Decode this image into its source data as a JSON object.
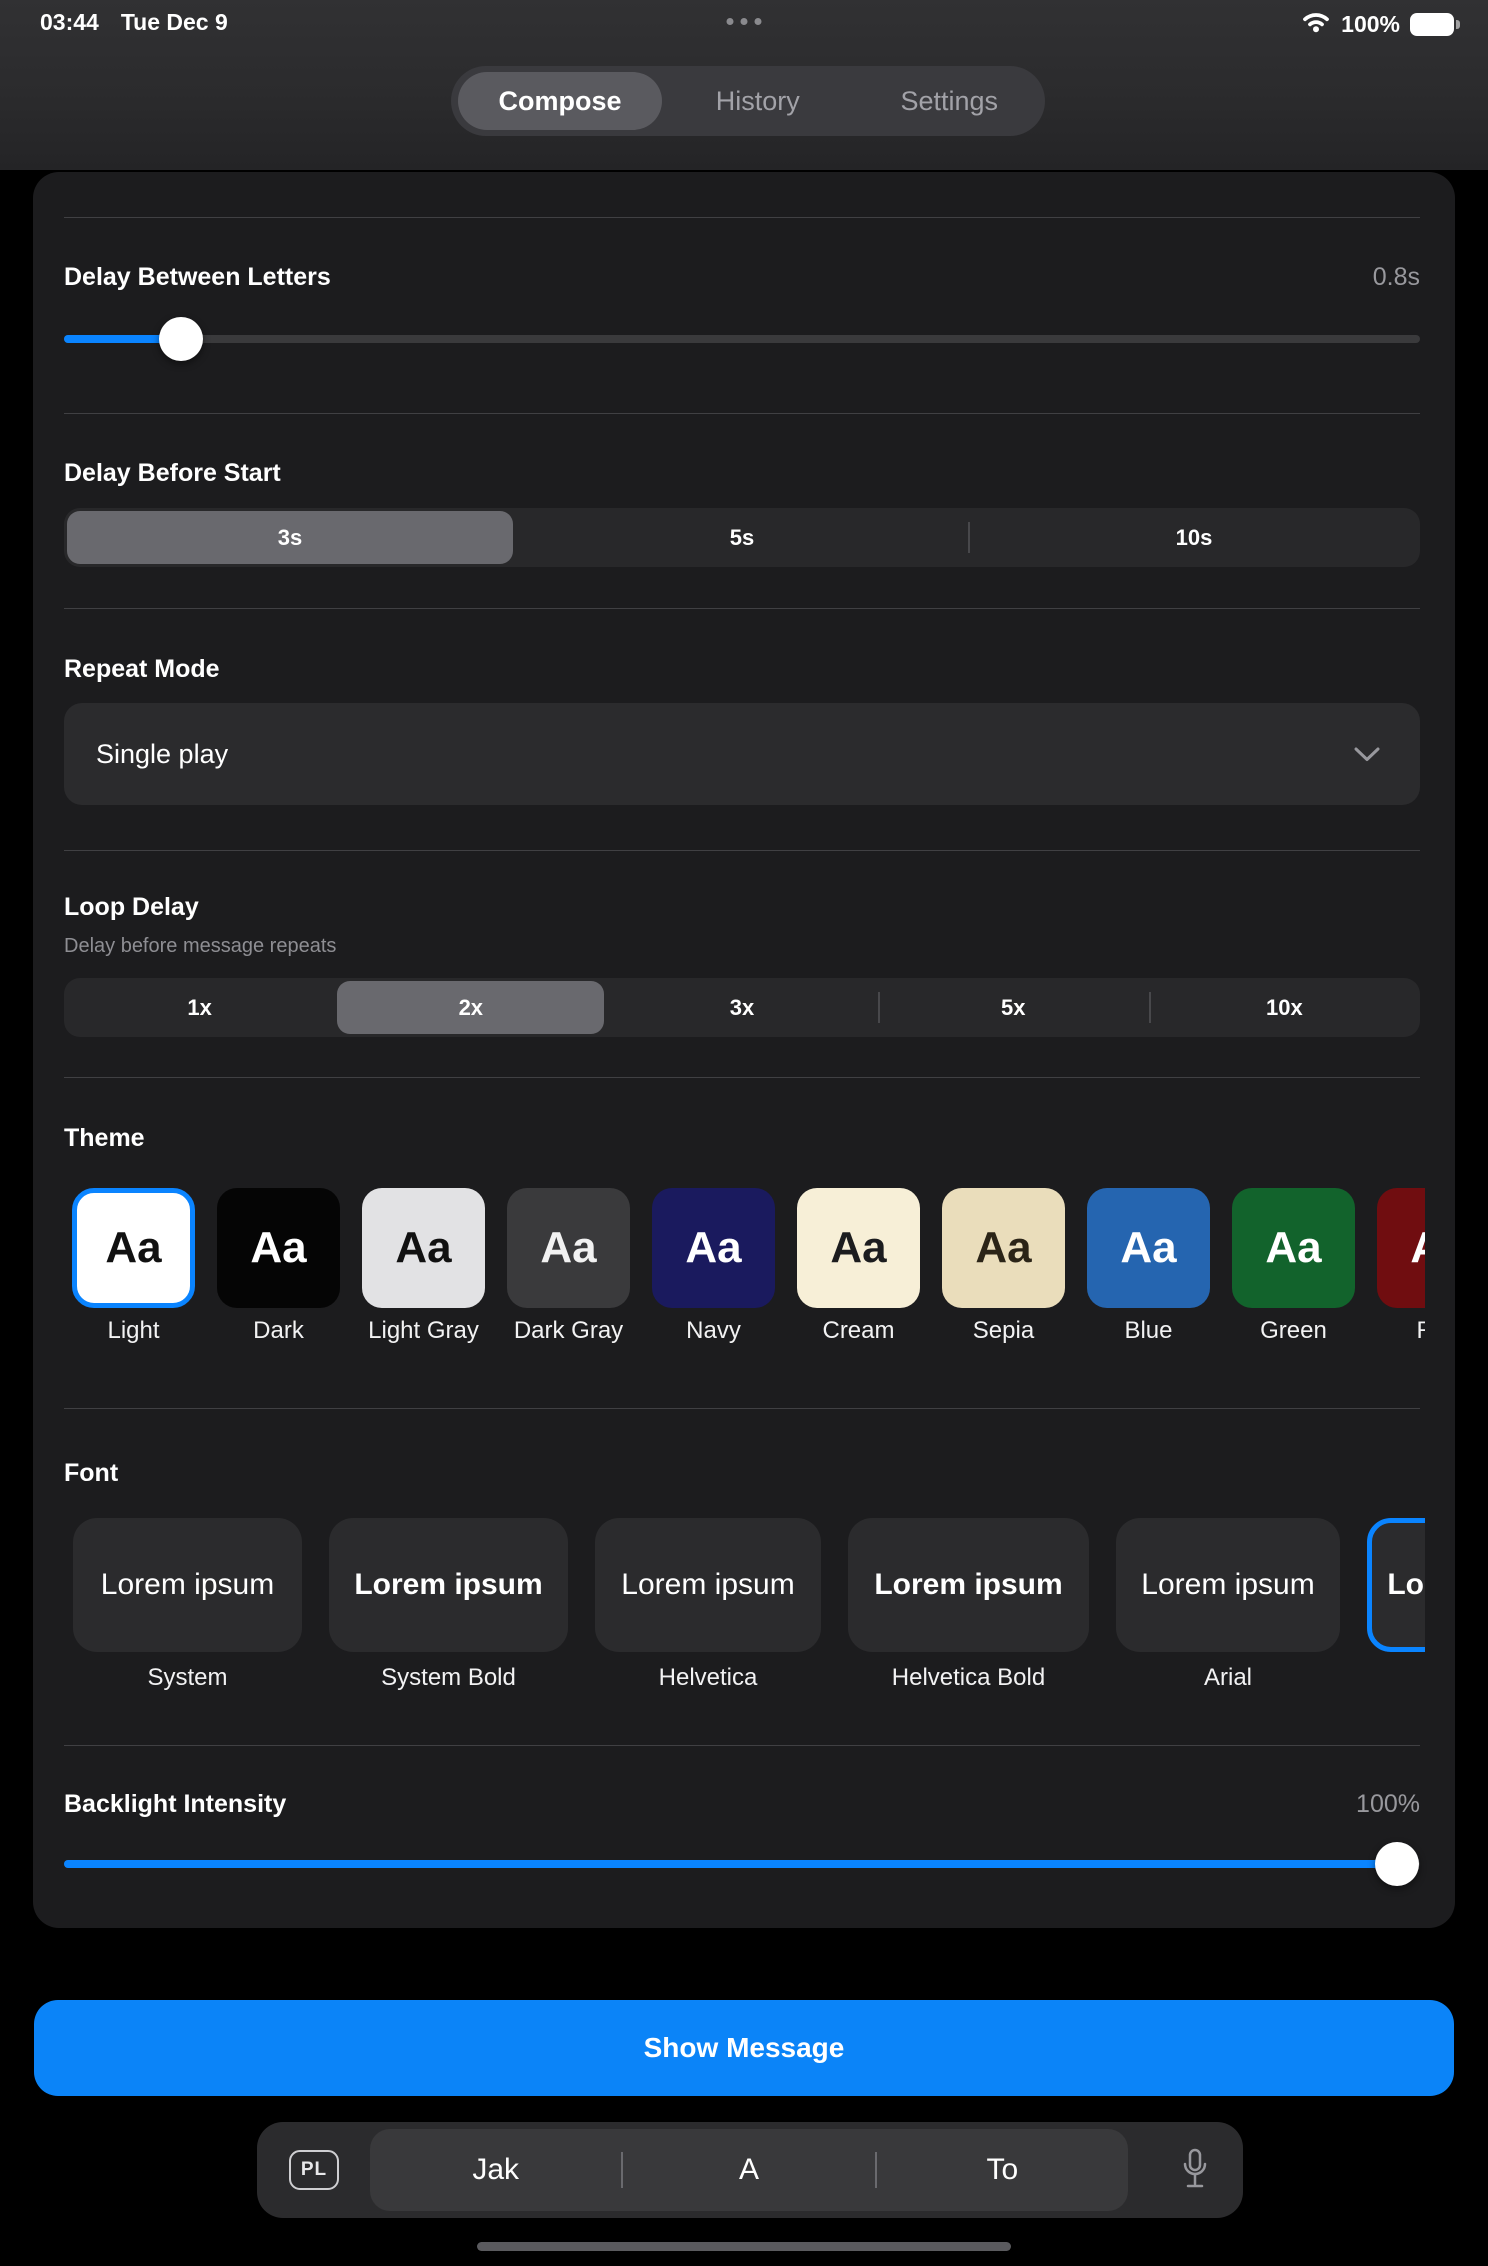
{
  "status_bar": {
    "time": "03:44",
    "date": "Tue Dec 9",
    "battery_percent": "100%"
  },
  "nav_tabs": {
    "compose": "Compose",
    "history": "History",
    "settings": "Settings"
  },
  "settings": {
    "delay_between_letters": {
      "label": "Delay Between Letters",
      "value": "0.8s",
      "slider_percent": "8.6%"
    },
    "delay_before_start": {
      "label": "Delay Before Start",
      "options": [
        {
          "label": "3s"
        },
        {
          "label": "5s"
        },
        {
          "label": "10s"
        }
      ],
      "selected": "3s"
    },
    "repeat_mode": {
      "label": "Repeat Mode",
      "value": "Single play"
    },
    "loop_delay": {
      "label": "Loop Delay",
      "subtitle": "Delay before message repeats",
      "options": [
        {
          "label": "1x"
        },
        {
          "label": "2x"
        },
        {
          "label": "3x"
        },
        {
          "label": "5x"
        },
        {
          "label": "10x"
        }
      ],
      "selected": "2x"
    },
    "theme": {
      "label": "Theme",
      "preview_text": "Aa",
      "items": [
        {
          "label": "Light",
          "bg": "#ffffff",
          "fg": "#111111",
          "selected": true
        },
        {
          "label": "Dark",
          "bg": "#050505",
          "fg": "#ffffff"
        },
        {
          "label": "Light Gray",
          "bg": "#e2e2e4",
          "fg": "#111111"
        },
        {
          "label": "Dark Gray",
          "bg": "#3a3a3c",
          "fg": "#f2f2f2"
        },
        {
          "label": "Navy",
          "bg": "#1a1a5e",
          "fg": "#ffffff"
        },
        {
          "label": "Cream",
          "bg": "#f7efd7",
          "fg": "#1c1c1e"
        },
        {
          "label": "Sepia",
          "bg": "#eaddbb",
          "fg": "#2b2417"
        },
        {
          "label": "Blue",
          "bg": "#2565b0",
          "fg": "#ffffff"
        },
        {
          "label": "Green",
          "bg": "#12632c",
          "fg": "#ffffff"
        },
        {
          "label": "Red",
          "bg": "#700d10",
          "fg": "#ffffff"
        }
      ]
    },
    "font": {
      "label": "Font",
      "sample": "Lorem ipsum",
      "items": [
        {
          "label": "System"
        },
        {
          "label": "System Bold"
        },
        {
          "label": "Helvetica"
        },
        {
          "label": "Helvetica Bold"
        },
        {
          "label": "Arial"
        },
        {
          "label": ""
        }
      ]
    },
    "backlight": {
      "label": "Backlight Intensity",
      "value": "100%",
      "slider_percent": "98.3%"
    }
  },
  "show_message_button": {
    "label": "Show Message"
  },
  "keyboard_bar": {
    "language_key": "PL",
    "suggestions": [
      "Jak",
      "A",
      "To"
    ]
  },
  "colors": {
    "accent": "#0a84ff",
    "card_bg": "#1c1c1e",
    "selected_segment": "#69696e"
  }
}
